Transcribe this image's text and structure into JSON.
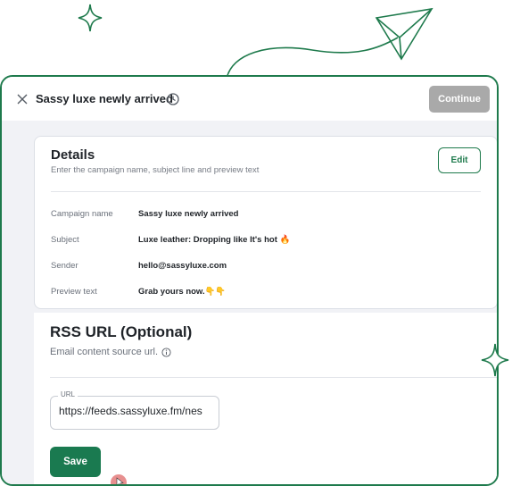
{
  "header": {
    "campaign_title": "Sassy luxe newly arrived",
    "continue_label": "Continue"
  },
  "details": {
    "title": "Details",
    "subtitle": "Enter the campaign name, subject line and preview text",
    "edit_label": "Edit",
    "fields": [
      {
        "label": "Campaign name",
        "value": "Sassy luxe newly arrived"
      },
      {
        "label": "Subject",
        "value": "Luxe leather: Dropping like It's hot 🔥"
      },
      {
        "label": "Sender",
        "value": "hello@sassyluxe.com"
      },
      {
        "label": "Preview text",
        "value": "Grab yours now.👇👇"
      }
    ]
  },
  "rss": {
    "title": "RSS URL (Optional)",
    "subtitle": "Email content source url.",
    "url_label": "URL",
    "url_value": "https://feeds.sassyluxe.fm/nes",
    "save_label": "Save"
  },
  "colors": {
    "brand_green": "#1e7a4c",
    "continue_disabled": "#a9a9a9",
    "canvas_bg": "#f1f2f6"
  }
}
